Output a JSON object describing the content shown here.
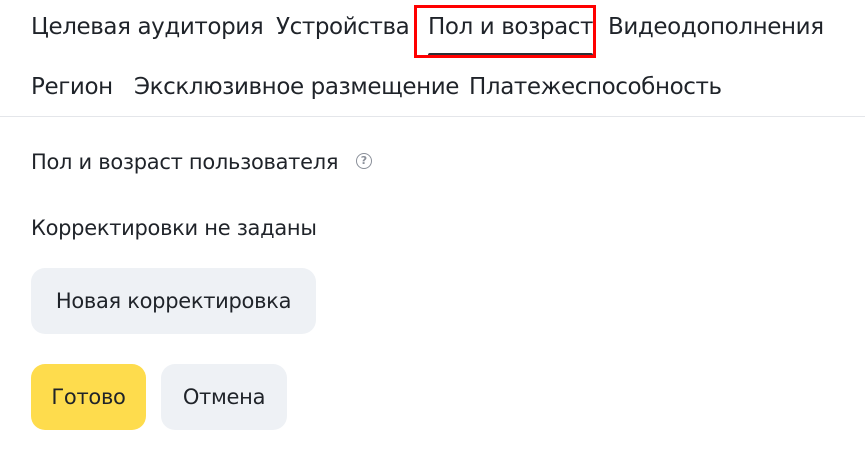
{
  "tabs": [
    {
      "label": "Целевая аудитория",
      "active": false
    },
    {
      "label": "Устройства",
      "active": false
    },
    {
      "label": "Пол и возраст",
      "active": true
    },
    {
      "label": "Видеодополнения",
      "active": false
    },
    {
      "label": "Регион",
      "active": false
    },
    {
      "label": "Эксклюзивное размещение",
      "active": false
    },
    {
      "label": "Платежеспособность",
      "active": false
    }
  ],
  "section": {
    "title": "Пол и возраст пользователя",
    "help_icon": "question-circle-icon",
    "help_symbol": "?",
    "status": "Корректировки не заданы"
  },
  "buttons": {
    "new_adjustment": "Новая корректировка",
    "done": "Готово",
    "cancel": "Отмена"
  },
  "colors": {
    "highlight": "#ff0000",
    "primary_button": "#fedc4d",
    "secondary_button": "#eef1f5",
    "active_tab_underline": "#2b2f36"
  }
}
